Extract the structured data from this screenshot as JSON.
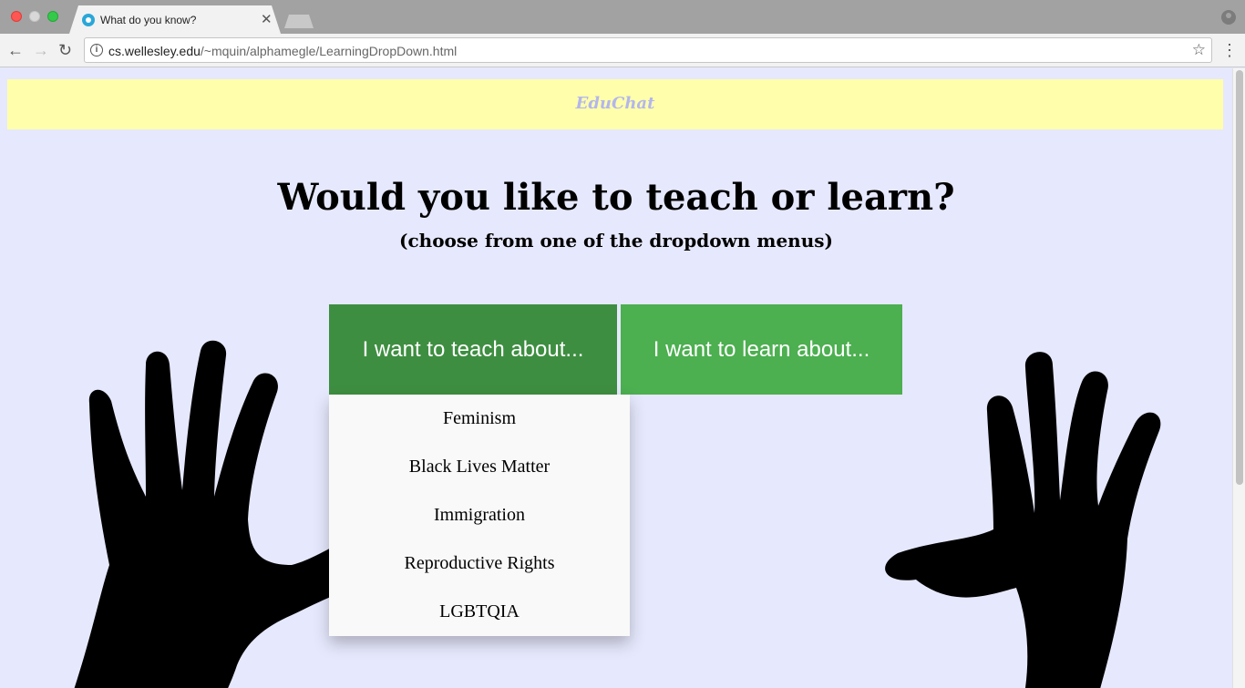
{
  "browser": {
    "tab_title": "What do you know?",
    "tab_close": "✕",
    "url_host": "cs.wellesley.edu",
    "url_path": "/~mquin/alphamegle/LearningDropDown.html",
    "nav_back": "←",
    "nav_forward": "→",
    "nav_reload": "↻",
    "info_glyph": "i",
    "star_glyph": "☆",
    "menu_glyph": "⋮"
  },
  "banner": {
    "brand": "EduChat"
  },
  "main": {
    "heading": "Would you like to teach or learn?",
    "subheading": "(choose from one of the dropdown menus)"
  },
  "dropdowns": {
    "teach_label": "I want to teach about...",
    "learn_label": "I want to learn about...",
    "teach_items": [
      "Feminism",
      "Black Lives Matter",
      "Immigration",
      "Reproductive Rights",
      "LGBTQIA"
    ]
  },
  "colors": {
    "page_bg": "#e6e8fd",
    "banner_bg": "#ffffab",
    "brand_text": "#b3b6ec",
    "teach_button": "#3e8e41",
    "learn_button": "#4caf50",
    "dropdown_bg": "#f9f9f9"
  },
  "icons": [
    "close-window-icon",
    "minimize-window-icon",
    "maximize-window-icon",
    "favicon-icon",
    "back-arrow-icon",
    "forward-arrow-icon",
    "reload-icon",
    "info-icon",
    "bookmark-star-icon",
    "profile-icon",
    "menu-dots-icon",
    "left-hand-icon",
    "right-hand-icon"
  ]
}
